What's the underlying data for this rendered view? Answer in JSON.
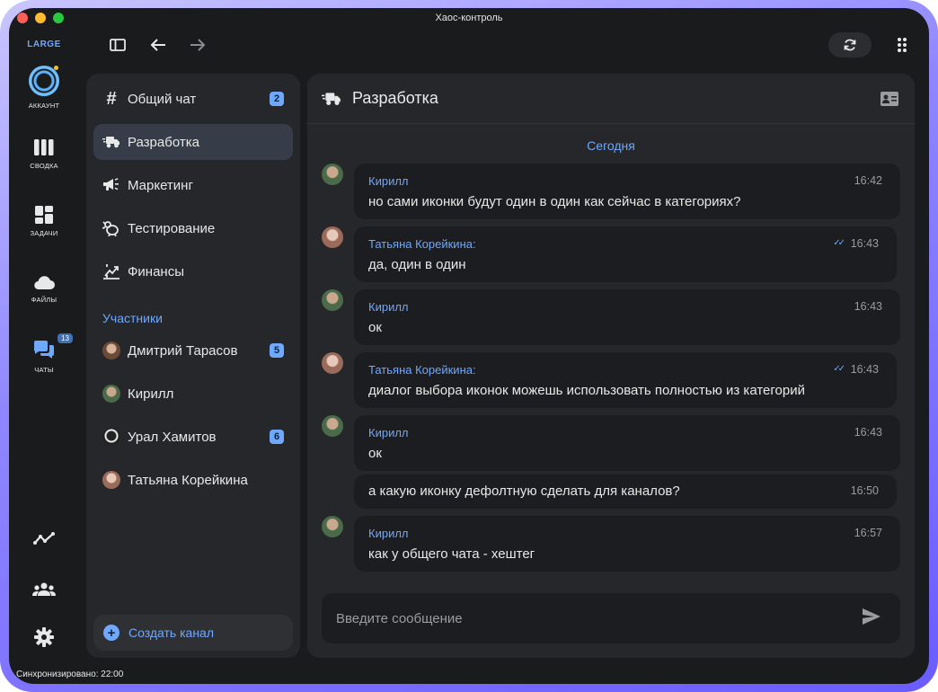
{
  "window": {
    "title": "Хаос-контроль"
  },
  "rail": {
    "brand": "LARGE",
    "items": [
      {
        "label": "АККАУНТ",
        "icon": "account-avatar"
      },
      {
        "label": "СВОДКА",
        "icon": "columns-icon"
      },
      {
        "label": "ЗАДАЧИ",
        "icon": "dashboard-icon"
      },
      {
        "label": "ФАЙЛЫ",
        "icon": "cloud-icon"
      },
      {
        "label": "ЧАТЫ",
        "icon": "chat-icon",
        "badge": "13"
      }
    ],
    "bottom_icons": [
      "analytics-icon",
      "group-icon",
      "settings-icon"
    ]
  },
  "toolbar": {
    "icons": [
      "sidebar-toggle-icon",
      "back-arrow-icon",
      "forward-arrow-icon",
      "refresh-icon",
      "menu-dots-icon"
    ]
  },
  "channels": {
    "items": [
      {
        "label": "Общий чат",
        "icon": "hashtag-icon",
        "badge": "2"
      },
      {
        "label": "Разработка",
        "icon": "truck-icon",
        "active": true
      },
      {
        "label": "Маркетинг",
        "icon": "megaphone-icon"
      },
      {
        "label": "Тестирование",
        "icon": "bug-icon"
      },
      {
        "label": "Финансы",
        "icon": "chart-icon"
      }
    ],
    "section_title": "Участники",
    "members": [
      {
        "name": "Дмитрий Тарасов",
        "badge": "5"
      },
      {
        "name": "Кирилл"
      },
      {
        "name": "Урал Хамитов",
        "badge": "6"
      },
      {
        "name": "Татьяна Корейкина"
      }
    ],
    "create_label": "Создать канал"
  },
  "chat": {
    "title": "Разработка",
    "day_label": "Сегодня",
    "messages": [
      {
        "author": "Кирилл",
        "time": "16:42",
        "text": "но сами иконки будут один в один как сейчас в категориях?"
      },
      {
        "author": "Татьяна Корейкина:",
        "time": "16:43",
        "text": "да, один в один",
        "read": "✓✓"
      },
      {
        "author": "Кирилл",
        "time": "16:43",
        "text": "ок"
      },
      {
        "author": "Татьяна Корейкина:",
        "time": "16:43",
        "text": "диалог выбора иконок можешь использовать полностью из категорий",
        "read": "✓✓"
      },
      {
        "author": "Кирилл",
        "time": "16:43",
        "text": "ок"
      },
      {
        "author": "",
        "time": "16:50",
        "text": "а какую иконку дефолтную сделать для каналов?"
      },
      {
        "author": "Кирилл",
        "time": "16:57",
        "text": "как у общего чата - хештег"
      }
    ],
    "composer_placeholder": "Введите сообщение"
  },
  "status": {
    "text": "Синхронизировано: 22:00"
  },
  "colors": {
    "accent": "#6ea8ff",
    "panel": "#26272a",
    "bubble": "#1c1d20",
    "background": "#1a1b1d"
  }
}
